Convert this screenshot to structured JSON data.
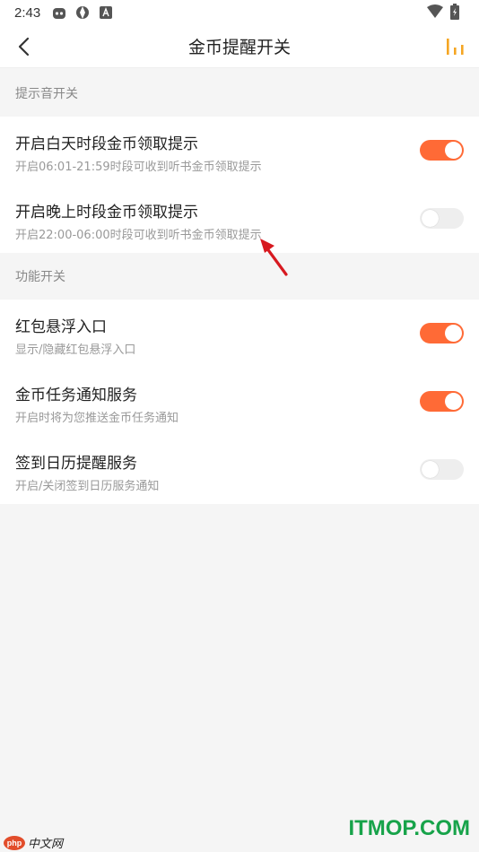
{
  "status_bar": {
    "time": "2:43"
  },
  "header": {
    "title": "金币提醒开关"
  },
  "sections": [
    {
      "title": "提示音开关",
      "items": [
        {
          "label": "开启白天时段金币领取提示",
          "desc": "开启06:01-21:59时段可收到听书金币领取提示",
          "enabled": true
        },
        {
          "label": "开启晚上时段金币领取提示",
          "desc": "开启22:00-06:00时段可收到听书金币领取提示",
          "enabled": false
        }
      ]
    },
    {
      "title": "功能开关",
      "items": [
        {
          "label": "红包悬浮入口",
          "desc": "显示/隐藏红包悬浮入口",
          "enabled": true
        },
        {
          "label": "金币任务通知服务",
          "desc": "开启时将为您推送金币任务通知",
          "enabled": true
        },
        {
          "label": "签到日历提醒服务",
          "desc": "开启/关闭签到日历服务通知",
          "enabled": false
        }
      ]
    }
  ],
  "colors": {
    "accent": "#ff6a36",
    "toggle_off": "#eeeeee",
    "background": "#f5f5f5",
    "header_icon": "#f5a623",
    "annotation_arrow": "#d71920"
  },
  "icons": {
    "back": "chevron-left-icon",
    "stats": "bar-chart-icon"
  },
  "watermarks": {
    "left_logo": "php",
    "left_text": "中文网",
    "right_text": "ITMOP.COM"
  }
}
